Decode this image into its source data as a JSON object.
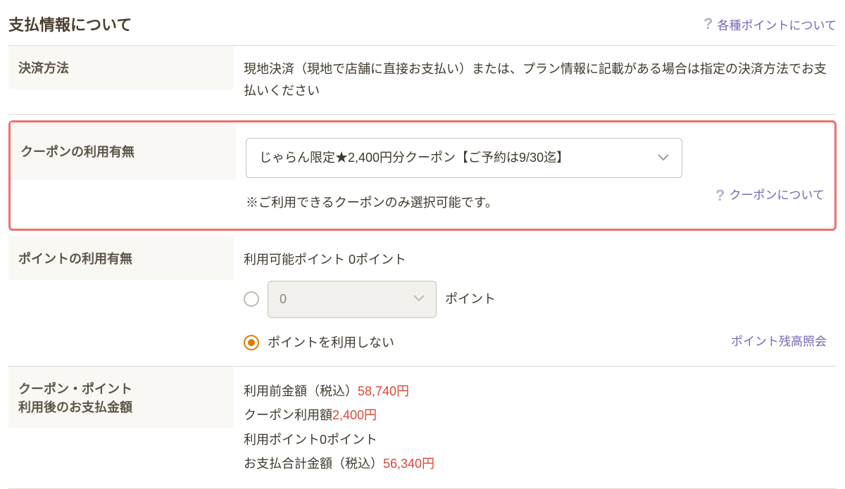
{
  "header": {
    "title": "支払情報について",
    "help_link": "各種ポイントについて"
  },
  "payment_method": {
    "label": "決済方法",
    "text": "現地決済（現地で店舗に直接お支払い）または、プラン情報に記載がある場合は指定の決済方法でお支払いください"
  },
  "coupon": {
    "label": "クーポンの利用有無",
    "selected": "じゃらん限定★2,400円分クーポン【ご予約は9/30迄】",
    "note": "※ご利用できるクーポンのみ選択可能です。",
    "help_link": "クーポンについて"
  },
  "points": {
    "label": "ポイントの利用有無",
    "available_prefix": "利用可能ポイント ",
    "available_value": "0ポイント",
    "input_value": "0",
    "input_unit": "ポイント",
    "no_use_label": "ポイントを利用しない",
    "balance_link": "ポイント残高照会"
  },
  "summary": {
    "label_line1": "クーポン・ポイント",
    "label_line2": "利用後のお支払金額",
    "before_label": "利用前金額（税込）",
    "before_value": "58,740円",
    "coupon_label": "クーポン利用額",
    "coupon_value": "2,400円",
    "points_label": "利用ポイント",
    "points_value": "0ポイント",
    "total_label": "お支払合計金額（税込）",
    "total_value": "56,340円"
  }
}
